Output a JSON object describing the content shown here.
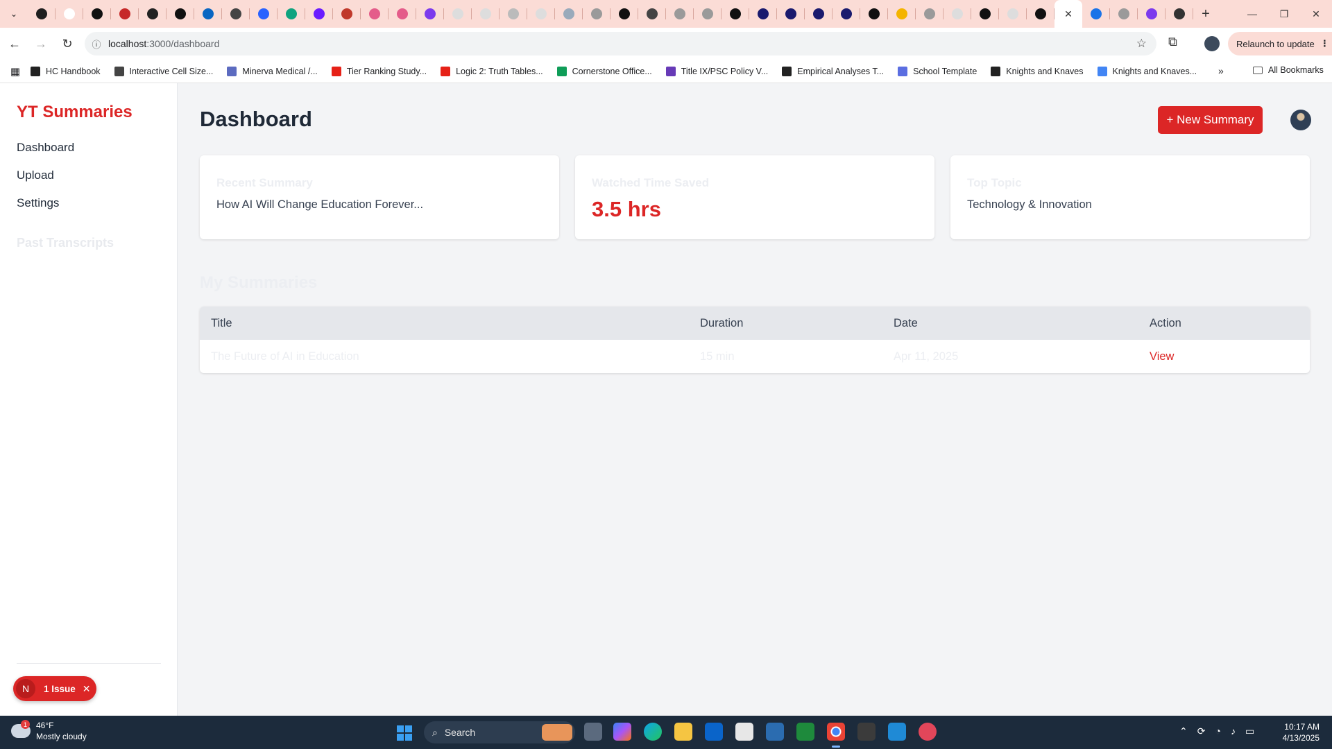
{
  "browser": {
    "url_host": "localhost",
    "url_path": ":3000/dashboard",
    "relaunch_label": "Relaunch to update",
    "tab_icons": [
      {
        "name": "pen-icon",
        "color": "#1f1f1f"
      },
      {
        "name": "google-icon",
        "color": "#ffffff"
      },
      {
        "name": "notion-icon",
        "color": "#111111"
      },
      {
        "name": "red-book-icon",
        "color": "#c62828"
      },
      {
        "name": "chatgpt-icon",
        "color": "#222222"
      },
      {
        "name": "notion-icon",
        "color": "#111111"
      },
      {
        "name": "linkedin-icon",
        "color": "#0a66c2"
      },
      {
        "name": "gear-icon",
        "color": "#444444"
      },
      {
        "name": "arc-icon",
        "color": "#2962ff"
      },
      {
        "name": "chatgpt-icon",
        "color": "#10a37f"
      },
      {
        "name": "app-icon",
        "color": "#6a1bff"
      },
      {
        "name": "spiral-icon",
        "color": "#c0392b"
      },
      {
        "name": "react-icon",
        "color": "#e45c8a"
      },
      {
        "name": "react-icon",
        "color": "#e45c8a"
      },
      {
        "name": "terminal-icon",
        "color": "#7c3aed"
      },
      {
        "name": "shield-icon",
        "color": "#dddddd"
      },
      {
        "name": "shield-icon",
        "color": "#dddddd"
      },
      {
        "name": "circle-icon",
        "color": "#bbbbbb"
      },
      {
        "name": "shield-icon",
        "color": "#dddddd"
      },
      {
        "name": "react-icon",
        "color": "#9ab"
      },
      {
        "name": "github-icon",
        "color": "#9a9a9a"
      },
      {
        "name": "vercel-icon",
        "color": "#111111"
      },
      {
        "name": "gear-icon",
        "color": "#444444"
      },
      {
        "name": "globe-icon",
        "color": "#9a9a9a"
      },
      {
        "name": "globe-icon",
        "color": "#9a9a9a"
      },
      {
        "name": "chatgpt-icon",
        "color": "#111111"
      },
      {
        "name": "chatgpt-icon",
        "color": "#1a1a6e"
      },
      {
        "name": "chatgpt-icon",
        "color": "#1a1a6e"
      },
      {
        "name": "chatgpt-icon",
        "color": "#1a1a6e"
      },
      {
        "name": "chatgpt-icon",
        "color": "#1a1a6e"
      },
      {
        "name": "chatgpt-icon",
        "color": "#111111"
      },
      {
        "name": "drive-icon",
        "color": "#f4b400"
      },
      {
        "name": "globe-icon",
        "color": "#9a9a9a"
      },
      {
        "name": "link-icon",
        "color": "#dddddd"
      },
      {
        "name": "link-icon",
        "color": "#111111"
      },
      {
        "name": "link-icon",
        "color": "#dddddd"
      },
      {
        "name": "chatgpt-icon",
        "color": "#111111"
      }
    ],
    "tab_icons_after": [
      {
        "name": "info-icon",
        "color": "#1a73e8"
      },
      {
        "name": "globe-icon",
        "color": "#9a9a9a"
      },
      {
        "name": "app-icon",
        "color": "#7c3aed"
      },
      {
        "name": "chrome-icon",
        "color": "#333333"
      }
    ],
    "bookmarks": [
      {
        "label": "HC Handbook",
        "icon": "github-icon",
        "color": "#222222"
      },
      {
        "label": "Interactive Cell Size...",
        "icon": "cell-icon",
        "color": "#444444"
      },
      {
        "label": "Minerva Medical /...",
        "icon": "building-icon",
        "color": "#5c6bc0"
      },
      {
        "label": "Tier Ranking Study...",
        "icon": "youtube-icon",
        "color": "#e62117"
      },
      {
        "label": "Logic 2: Truth Tables...",
        "icon": "youtube-icon",
        "color": "#e62117"
      },
      {
        "label": "Cornerstone Office...",
        "icon": "sheets-icon",
        "color": "#0f9d58"
      },
      {
        "label": "Title IX/PSC Policy V...",
        "icon": "forms-icon",
        "color": "#673ab7"
      },
      {
        "label": "Empirical Analyses T...",
        "icon": "github-icon",
        "color": "#222222"
      },
      {
        "label": "School Template",
        "icon": "gear-icon",
        "color": "#5b6ee1"
      },
      {
        "label": "Knights and Knaves",
        "icon": "github-icon",
        "color": "#222222"
      },
      {
        "label": "Knights and Knaves...",
        "icon": "docs-icon",
        "color": "#4285f4"
      }
    ],
    "all_bookmarks": "All Bookmarks"
  },
  "sidebar": {
    "brand": "YT Summaries",
    "nav": [
      "Dashboard",
      "Upload",
      "Settings"
    ],
    "past_title": "Past Transcripts"
  },
  "issue_badge": {
    "letter": "N",
    "label": "1 Issue"
  },
  "header": {
    "title": "Dashboard",
    "new_button": "+ New Summary"
  },
  "cards": [
    {
      "label": "Recent Summary",
      "text": "How AI Will Change Education Forever..."
    },
    {
      "label": "Watched Time Saved",
      "value": "3.5 hrs"
    },
    {
      "label": "Top Topic",
      "text": "Technology & Innovation"
    }
  ],
  "summaries": {
    "title": "My Summaries",
    "columns": [
      "Title",
      "Duration",
      "Date",
      "Action"
    ],
    "rows": [
      {
        "title": "The Future of AI in Education",
        "duration": "15 min",
        "date": "Apr 11, 2025",
        "action": "View"
      }
    ]
  },
  "taskbar": {
    "weather_temp": "46°F",
    "weather_desc": "Mostly cloudy",
    "weather_badge": "1",
    "search_label": "Search",
    "time": "10:17 AM",
    "date": "4/13/2025"
  },
  "colors": {
    "accent": "#dc2626",
    "tabstrip": "#fbdcd6",
    "taskbar": "#1c2b3c"
  }
}
